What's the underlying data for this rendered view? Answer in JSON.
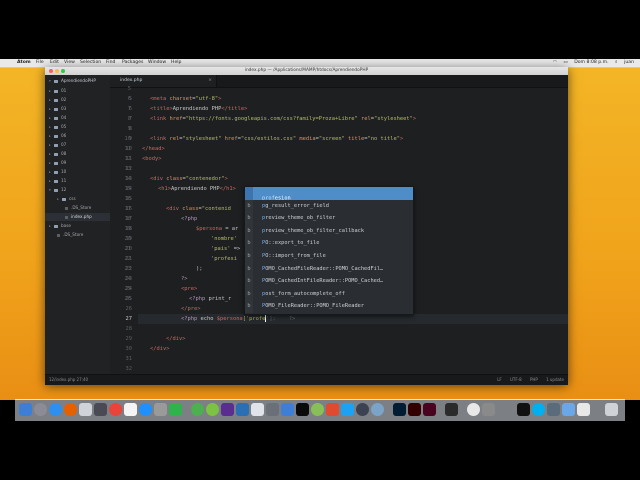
{
  "menubar": {
    "items": [
      "Atom",
      "File",
      "Edit",
      "View",
      "Selection",
      "Find",
      "Packages",
      "Window",
      "Help"
    ],
    "clock": "Dom 8:08 p.m.",
    "user": "juan"
  },
  "window": {
    "title": "index.php — /Applications/MAMP/htdocs/AprendiendoPHP"
  },
  "tree": {
    "project": "AprendiendoPHP",
    "items": [
      "01",
      "02",
      "03",
      "04",
      "05",
      "06",
      "07",
      "08",
      "09",
      "10",
      "11",
      "12",
      "css",
      ".DS_Store",
      "index.php",
      "base",
      ".DS_Store"
    ]
  },
  "tab": {
    "label": "index.php",
    "close": "×"
  },
  "gutter": {
    "lines": [
      "5",
      "6",
      "7",
      "8",
      "9",
      "10",
      "11",
      "12",
      "13",
      "14",
      "15",
      "16",
      "17",
      "18",
      "19",
      "20",
      "21",
      "22",
      "23",
      "24",
      "25",
      "26",
      "27",
      "28",
      "29",
      "30",
      "31",
      "32"
    ]
  },
  "code": {
    "l5": {
      "t1": "<meta ",
      "a1": "charset",
      "p1": "=",
      "s1": "\"utf-8\"",
      "t2": ">"
    },
    "l6": {
      "t1": "<title>",
      "x1": "Aprendiendo PHP",
      "t2": "</title>"
    },
    "l7": {
      "t1": "<link ",
      "a1": "href",
      "p1": "=",
      "s1": "\"https://fonts.googleapis.com/css?family=Proza+Libre\"",
      "a2": " rel",
      "p2": "=",
      "s2": "\"stylesheet\"",
      "t2": ">"
    },
    "l9": {
      "t1": "<link ",
      "a1": "rel",
      "p1": "=",
      "s1": "\"stylesheet\"",
      "a2": " href",
      "p2": "=",
      "s2": "\"css/estilos.css\"",
      "a3": " media",
      "p3": "=",
      "s3": "\"screen\"",
      "a4": " title",
      "p4": "=",
      "s4": "\"no title\"",
      "t2": ">"
    },
    "l10": {
      "t1": "</head>"
    },
    "l11": {
      "t1": "<body>"
    },
    "l13": {
      "t1": "<div ",
      "a1": "class",
      "p1": "=",
      "s1": "\"contenedor\"",
      "t2": ">"
    },
    "l14": {
      "t1": "<h1>",
      "x1": "Aprendiendo PHP",
      "t2": "</h1>"
    },
    "l16": {
      "t1": "<div ",
      "a1": "class",
      "p1": "=",
      "s1": "\"contenid"
    },
    "l17": {
      "ph": "<?php"
    },
    "l18": {
      "v": "$persona",
      "r": " = ar"
    },
    "l19": {
      "s": "'nombre'"
    },
    "l20": {
      "s": "'pais'",
      "r": " => "
    },
    "l21": {
      "s": "'profesi"
    },
    "l22": {
      "r": ");"
    },
    "l23": {
      "ph": "?>"
    },
    "l24": {
      "t1": "<pre>"
    },
    "l25": {
      "ph": "<?php",
      "r": " print_r"
    },
    "l26": {
      "t1": "</pre>"
    },
    "l27": {
      "ph": "<?php",
      "r1": " echo ",
      "v": "$persona",
      "r2": "['profe",
      "c": "'];",
      "ph2": "?>"
    },
    "l29": {
      "t1": "</div>"
    },
    "l30": {
      "t1": "</div>"
    }
  },
  "autocomplete": {
    "items": [
      {
        "icon": "",
        "match": "prof",
        "rest": "esion"
      },
      {
        "icon": "b",
        "match": "p",
        "rest": "g_result_error_field"
      },
      {
        "icon": "b",
        "match": "p",
        "rest": "review_theme_ob_filter"
      },
      {
        "icon": "b",
        "match": "p",
        "rest": "review_theme_ob_filter_callback"
      },
      {
        "icon": "b",
        "match": "P",
        "rest": "O::export_to_file"
      },
      {
        "icon": "b",
        "match": "P",
        "rest": "O::import_from_file"
      },
      {
        "icon": "b",
        "match": "P",
        "rest": "OMO_CachedFileReader::POMO_CachedFil…"
      },
      {
        "icon": "b",
        "match": "P",
        "rest": "OMO_CachedIntFileReader::POMO_Cached…"
      },
      {
        "icon": "b",
        "match": "p",
        "rest": "ost_form_autocomplete_off"
      },
      {
        "icon": "b",
        "match": "P",
        "rest": "OMO_FileReader::POMO_FileReader"
      }
    ]
  },
  "status": {
    "left": "12/index.php  27:40",
    "right": [
      "LF",
      "UTF-8",
      "PHP",
      "1 update"
    ]
  },
  "colors": {
    "wallpaper": "#f0a21b",
    "editor_bg": "#1d1f21",
    "selection": "#4f8dc8"
  }
}
